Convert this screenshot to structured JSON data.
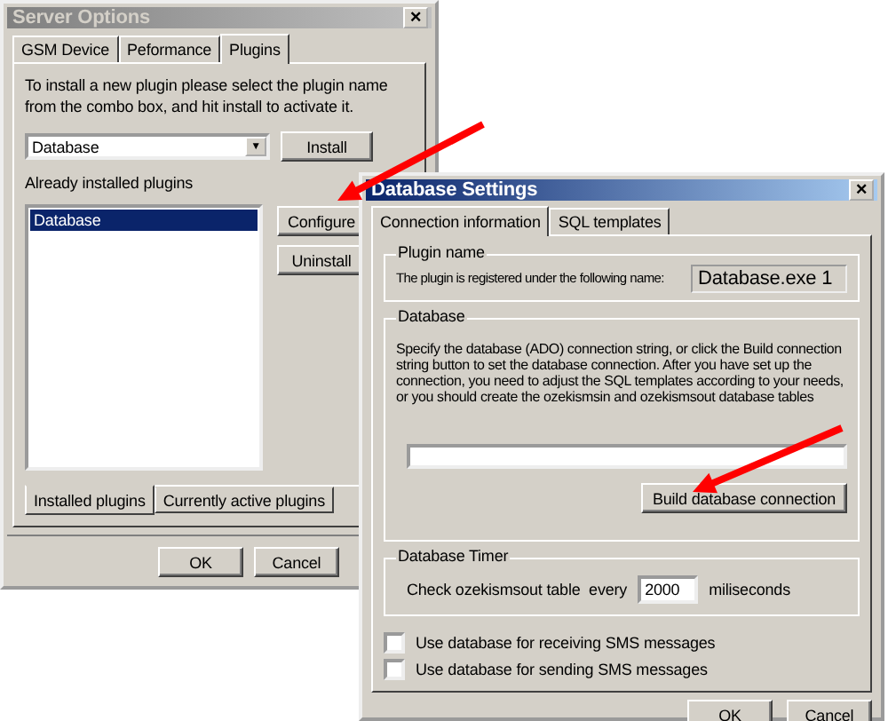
{
  "server_options": {
    "title": "Server Options",
    "close": "×",
    "tabs": [
      {
        "label": "GSM Device",
        "selected": false
      },
      {
        "label": "Peformance",
        "selected": false
      },
      {
        "label": "Plugins",
        "selected": true
      }
    ],
    "instructions": "To install a new plugin please select the plugin name from the combo box, and hit install to activate it.",
    "plugin_combo": {
      "value": "Database",
      "arrow": "▼"
    },
    "install_button": "Install",
    "installed_label": "Already installed plugins",
    "installed_list": [
      {
        "label": "Database",
        "selected": true
      }
    ],
    "configure_button": "Configure",
    "uninstall_button": "Uninstall",
    "bottom_tabs": [
      {
        "label": "Installed plugins",
        "selected": true
      },
      {
        "label": "Currently active plugins",
        "selected": false
      }
    ],
    "buttons": [
      "OK",
      "Cancel"
    ]
  },
  "database_settings": {
    "title": "Database Settings",
    "close": "×",
    "active": true,
    "tabs": [
      {
        "label": "Connection information",
        "selected": true
      },
      {
        "label": "SQL templates",
        "selected": false
      }
    ],
    "plugin_name_group": {
      "title": "Plugin name",
      "label": "The plugin is registered under the following name:",
      "value": "Database.exe 1"
    },
    "database_group": {
      "title": "Database",
      "description": "Specify the database (ADO) connection string, or click the Build connection string button to set the database connection. After you have set up the connection, you need to adjust the SQL templates according to your needs, or you should create the ozekismsin and ozekismsout database tables",
      "build_button": "Build database connection"
    },
    "timer_group": {
      "title": "Database Timer",
      "label": "Check ozekismsout table  every",
      "value": "2000",
      "unit": "miliseconds"
    },
    "checkboxes": [
      {
        "label": "Use database for receiving SMS messages",
        "checked": false
      },
      {
        "label": "Use database for sending SMS messages",
        "checked": false
      }
    ],
    "buttons": [
      "OK",
      "Cancel"
    ]
  }
}
